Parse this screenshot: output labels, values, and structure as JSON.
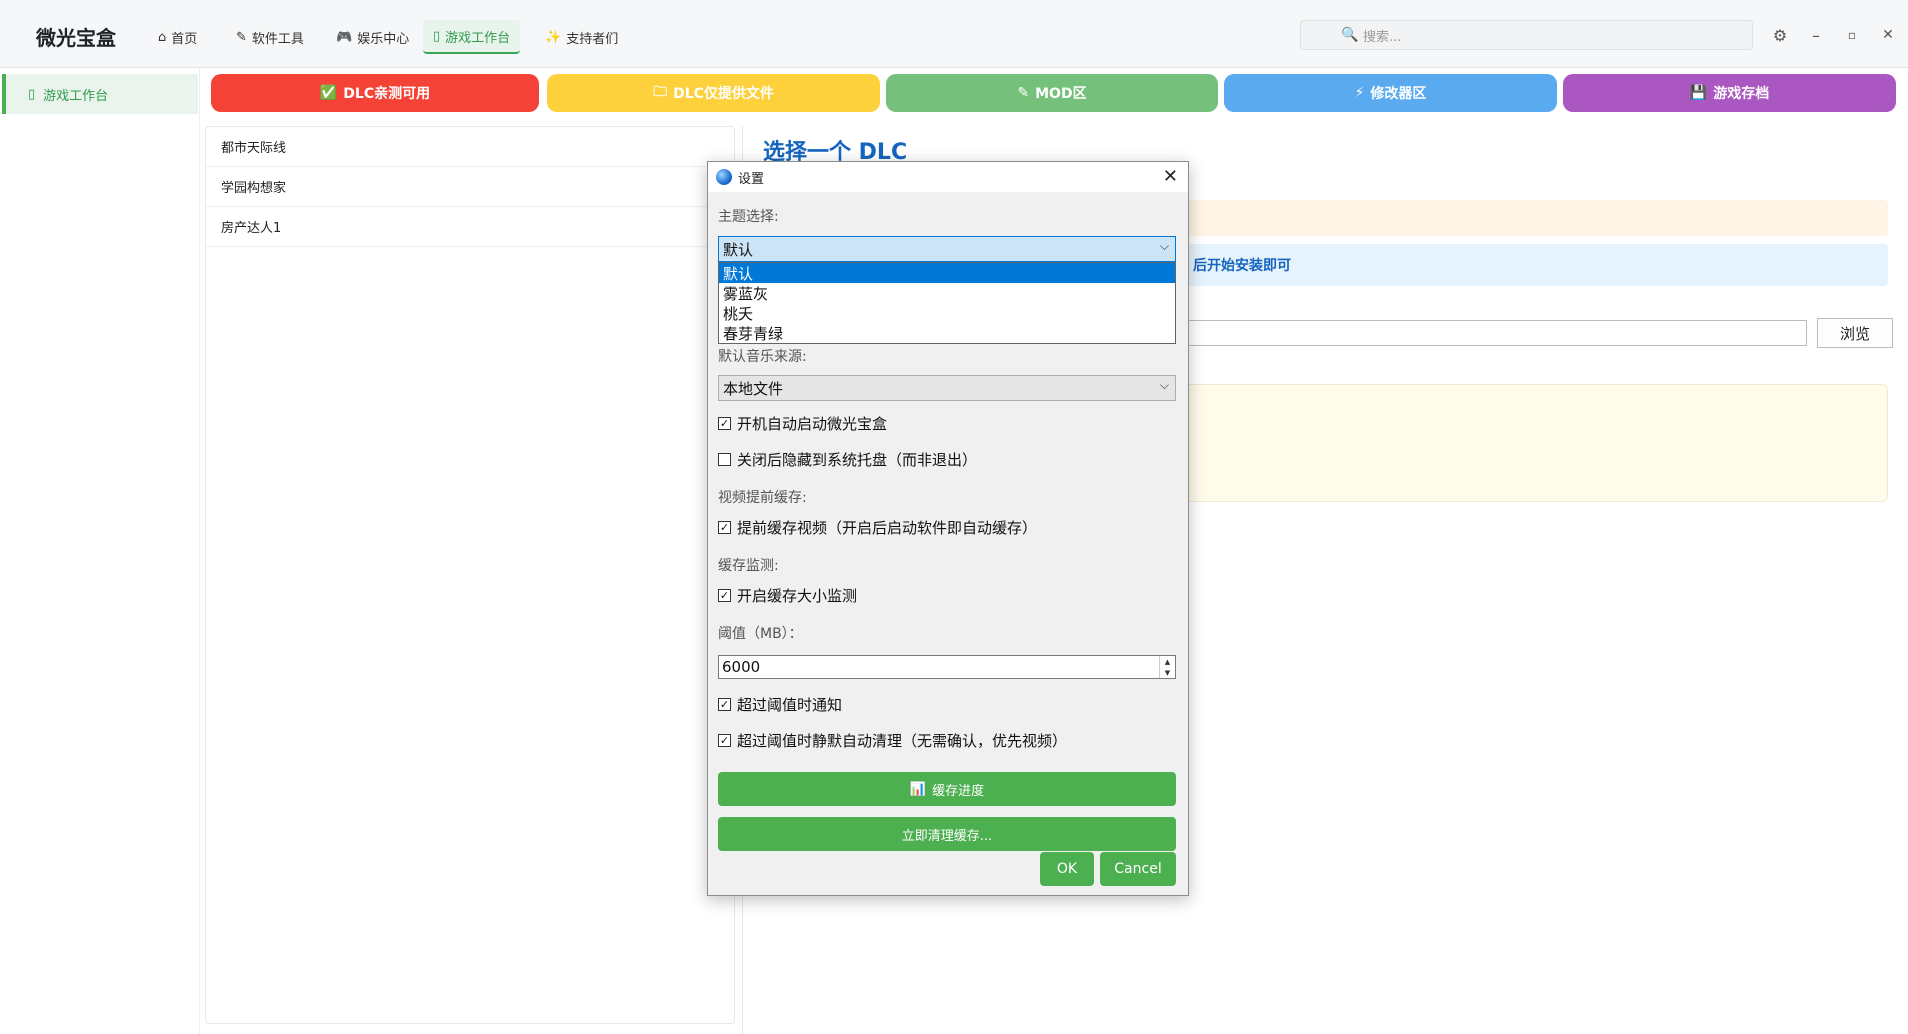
{
  "app": {
    "title": "微光宝盒"
  },
  "nav": {
    "items": [
      {
        "label": "首页",
        "icon": "home-icon",
        "glyph": "⌂"
      },
      {
        "label": "软件工具",
        "icon": "pencil-icon",
        "glyph": "✎"
      },
      {
        "label": "娱乐中心",
        "icon": "gamepad-icon",
        "glyph": "🎮"
      },
      {
        "label": "游戏工作台",
        "icon": "tablet-icon",
        "glyph": "▯"
      },
      {
        "label": "支持者们",
        "icon": "star-icon",
        "glyph": "✨"
      }
    ],
    "active": "游戏工作台"
  },
  "search": {
    "placeholder": "搜索..."
  },
  "window_controls": {
    "settings_glyph": "⚙",
    "minimize_glyph": "–",
    "maximize_glyph": "▫",
    "close_glyph": "✕"
  },
  "sidebar": {
    "items": [
      {
        "label": "游戏工作台",
        "glyph": "▯"
      }
    ]
  },
  "categories": [
    {
      "label": "DLC亲测可用",
      "glyph": "✅",
      "color": "#f44336"
    },
    {
      "label": "DLC仅提供文件",
      "glyph": "🗀",
      "color": "#fdd13c"
    },
    {
      "label": "MOD区",
      "glyph": "✎",
      "color": "#75c07a"
    },
    {
      "label": "修改器区",
      "glyph": "⚡",
      "color": "#5aaaf0"
    },
    {
      "label": "游戏存档",
      "glyph": "💾",
      "color": "#ab57c2"
    }
  ],
  "dlc_list": {
    "items": [
      "都市天际线",
      "学园构想家",
      "房产达人1"
    ]
  },
  "content": {
    "title": "选择一个 DLC",
    "info_text": "后开始安装即可",
    "browse_label": "浏览"
  },
  "dialog": {
    "title": "设置",
    "theme_label": "主题选择:",
    "theme_value": "默认",
    "theme_options": [
      "默认",
      "雾蓝灰",
      "桃夭",
      "春芽青绿"
    ],
    "music_label": "默认音乐来源:",
    "music_value": "本地文件",
    "autostart_label": "开机自动启动微光宝盒",
    "autostart_checked": true,
    "tray_label": "关闭后隐藏到系统托盘（而非退出）",
    "tray_checked": false,
    "video_cache_section": "视频提前缓存:",
    "precache_label": "提前缓存视频（开启后启动软件即自动缓存）",
    "precache_checked": true,
    "monitor_section": "缓存监测:",
    "monitor_label": "开启缓存大小监测",
    "monitor_checked": true,
    "threshold_label": "阈值（MB）：",
    "threshold_value": "6000",
    "notify_label": "超过阈值时通知",
    "notify_checked": true,
    "autoclean_label": "超过阈值时静默自动清理（无需确认，优先视频）",
    "autoclean_checked": true,
    "progress_button": "缓存进度",
    "progress_glyph": "📊",
    "clean_button": "立即清理缓存...",
    "ok_label": "OK",
    "cancel_label": "Cancel"
  },
  "colors": {
    "accent_green": "#4caf50",
    "title_blue": "#1565c0"
  }
}
